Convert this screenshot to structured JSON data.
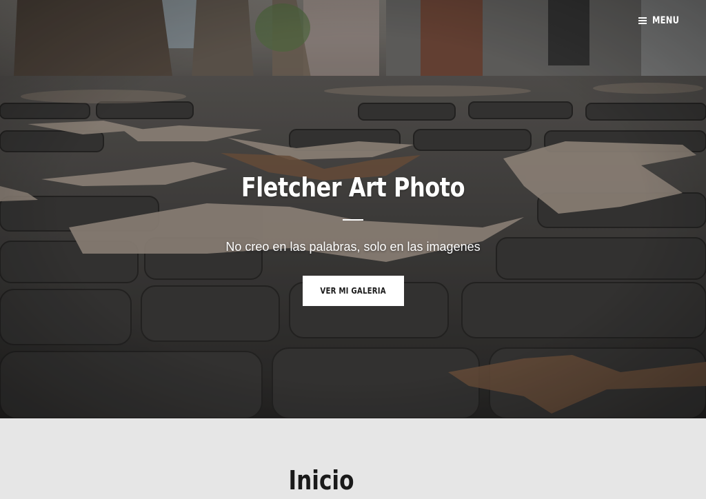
{
  "header": {
    "menu_label": "MENU",
    "menu_icon": "hamburger-icon"
  },
  "hero": {
    "title": "Fletcher Art Photo",
    "tagline": "No creo en las palabras, solo en las imagenes",
    "cta_label": "VER MI GALERIA",
    "background_image": "cobblestone street with fallen leaves"
  },
  "main": {
    "section_title": "Inicio"
  },
  "colors": {
    "content_bg": "#e6e6e6",
    "button_bg": "#ffffff",
    "button_text": "#1b1b1b",
    "heading_text": "#1a1a1a"
  }
}
